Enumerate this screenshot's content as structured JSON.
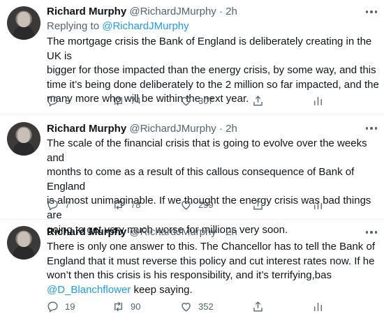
{
  "tweets": [
    {
      "name": "Richard Murphy",
      "handle": "@RichardJMurphy",
      "time": "· 2h",
      "reply_prefix": "Replying to",
      "reply_to": "@RichardJMurphy",
      "lines": [
        "The mortgage crisis the Bank of England is deliberately creating in the UK is",
        "bigger for those impacted than the energy crisis, by some way, and this",
        "time it’s being done deliberately to the 2 million so far impacted, and the",
        "many more who will be within the next year."
      ],
      "replies": "3",
      "retweets": "74",
      "likes": "307"
    },
    {
      "name": "Richard Murphy",
      "handle": "@RichardJMurphy",
      "time": "· 2h",
      "lines": [
        "The scale of the financial crisis that is going to evolve over the weeks and",
        "months to come as a result of this callous consequence of Bank of England",
        "is almost unimaginable. If we thought the energy crisis was bad things are",
        "going to get very much worse for millions very soon."
      ],
      "replies": "7",
      "retweets": "78",
      "likes": "299"
    },
    {
      "name": "Richard Murphy",
      "handle": "@RichardJMurphy",
      "time": "· 2h",
      "lines": [
        "There is only one answer to this. The Chancellor has to tell the Bank of",
        "England that it must reverse this policy and cut interest rates now. If he",
        "won’t then this crisis is his responsibility, and it’s terrifying,bas"
      ],
      "last_line_mention": "@D_Blanchflower",
      "last_line_rest": " keep saying.",
      "replies": "19",
      "retweets": "90",
      "likes": "352"
    }
  ],
  "icons": {
    "reply": "reply-icon",
    "retweet": "retweet-icon",
    "like": "heart-icon",
    "share": "share-icon",
    "analytics": "analytics-icon",
    "more": "more-icon"
  },
  "colors": {
    "link": "#1d9bf0",
    "secondary_text": "#536471",
    "primary_text": "#0f1419"
  }
}
